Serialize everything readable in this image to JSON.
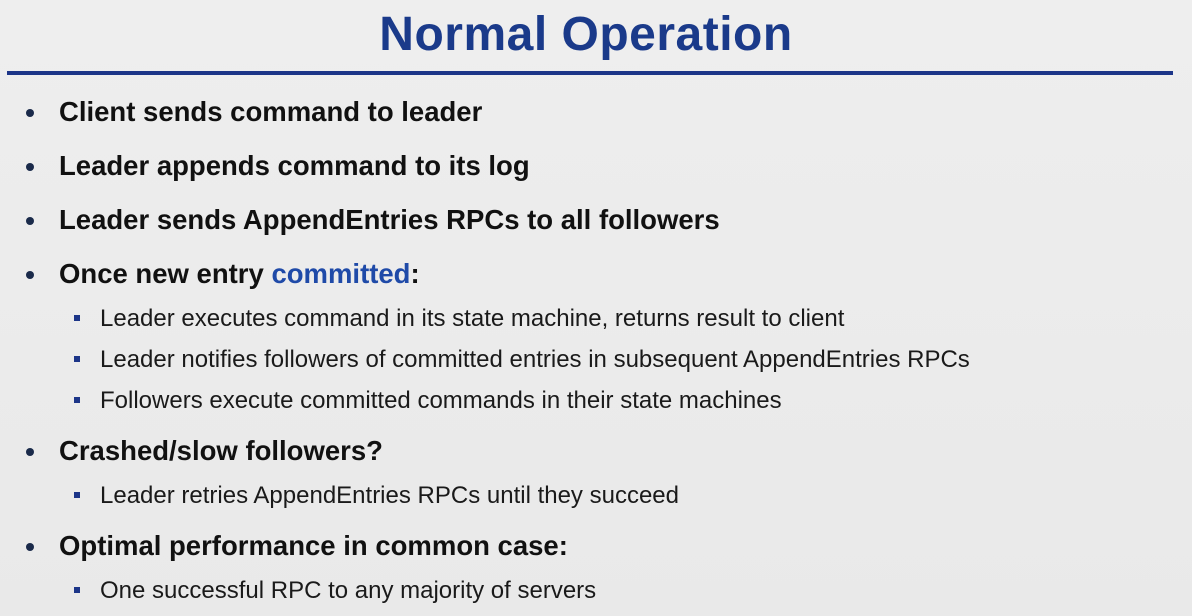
{
  "slide": {
    "title": "Normal Operation",
    "bullets": [
      {
        "text": "Client sends command to leader"
      },
      {
        "text": "Leader appends command to its log"
      },
      {
        "text": "Leader sends AppendEntries RPCs to all followers"
      },
      {
        "text_before": "Once new entry ",
        "highlight": "committed",
        "text_after": ":",
        "sub": [
          "Leader executes command in its state machine, returns result to client",
          "Leader notifies followers of committed entries in subsequent AppendEntries RPCs",
          "Followers execute committed commands in their state machines"
        ]
      },
      {
        "text": "Crashed/slow followers?",
        "sub": [
          "Leader retries AppendEntries RPCs until they succeed"
        ]
      },
      {
        "text": "Optimal performance in common case:",
        "sub": [
          "One successful RPC to any majority of servers"
        ]
      }
    ]
  },
  "colors": {
    "title": "#1a3a8a",
    "rule": "#1c3588",
    "highlight": "#1f4aa8",
    "background": "#ececec"
  }
}
